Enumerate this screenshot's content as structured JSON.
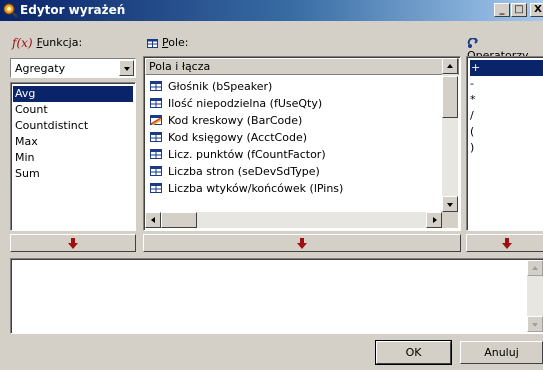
{
  "window": {
    "title": "Edytor wyrażeń",
    "buttons": {
      "minimize": "_",
      "maximize": "□",
      "close": "X"
    }
  },
  "functions": {
    "label_prefix": "",
    "label_accel": "F",
    "label_rest": "unkcja:",
    "category": "Agregaty",
    "items": [
      "Avg",
      "Count",
      "Countdistinct",
      "Max",
      "Min",
      "Sum"
    ],
    "selected_index": 0
  },
  "fields": {
    "label_accel": "P",
    "label_rest": "ole:",
    "column_header": "Pola i łącza",
    "items": [
      {
        "label": "Głośnik (bSpeaker)",
        "icon": "field-icon"
      },
      {
        "label": "Ilość niepodzielna (fUseQty)",
        "icon": "field-icon"
      },
      {
        "label": "Kod kreskowy (BarCode)",
        "icon": "barcode-field-icon"
      },
      {
        "label": "Kod księgowy (AcctCode)",
        "icon": "field-icon"
      },
      {
        "label": "Licz. punktów (fCountFactor)",
        "icon": "field-icon"
      },
      {
        "label": "Liczba stron (seDevSdType)",
        "icon": "field-icon"
      },
      {
        "label": "Liczba wtyków/końcówek (lPins)",
        "icon": "field-icon"
      }
    ]
  },
  "operators": {
    "label_accel": "O",
    "label_rest": "peratorzy",
    "items": [
      "+",
      "-",
      "*",
      "/",
      "(",
      ")"
    ],
    "selected_index": 0
  },
  "buttons": {
    "ok": "OK",
    "cancel": "Anuluj"
  },
  "colors": {
    "selection": "#0a246a",
    "insert_arrow": "#a01010"
  }
}
